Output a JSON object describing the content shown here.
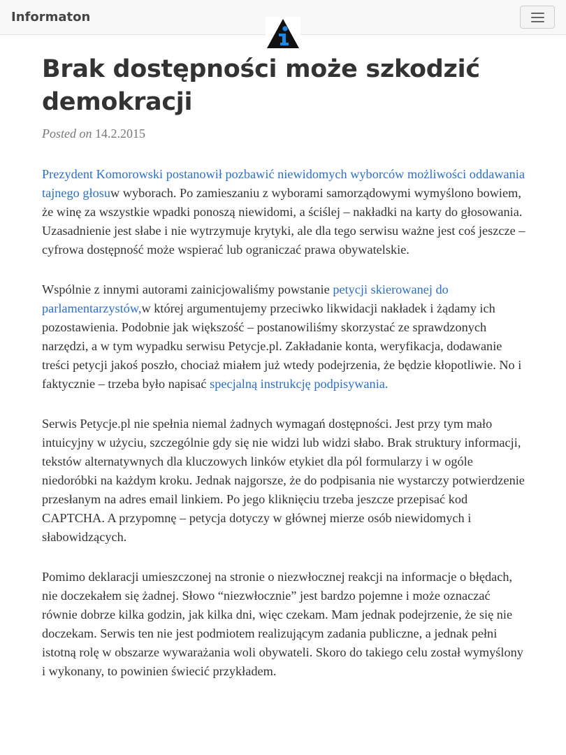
{
  "navbar": {
    "brand": "Informaton",
    "logo_icon": "info-triangle-logo-icon",
    "menu_icon": "hamburger-menu-icon"
  },
  "article": {
    "title": "Brak dostępności może szkodzić demokracji",
    "posted_label": "Posted on",
    "posted_date": "14.2.2015",
    "p1": {
      "link": "Prezydent Komorowski postanowił pozbawić niewidomych wyborców możliwości oddawania tajnego głosu",
      "text": "w wyborach. Po zamieszaniu z wyborami samorządowymi wymyślono bowiem, że winę za wszystkie wpadki ponoszą niewidomi, a ściślej – nakładki na karty do głosowania. Uzasadnienie jest słabe i nie wytrzymuje krytyki, ale dla tego serwisu ważne jest coś jeszcze – cyfrowa dostępność może wspierać lub ograniczać prawa obywatelskie."
    },
    "p2": {
      "text1": "Wspólnie z innymi autorami zainicjowaliśmy powstanie ",
      "link1": "petycji skierowanej do parlamentarzystów,",
      "text2": "w której argumentujemy przeciwko likwidacji nakładek i żądamy ich pozostawienia. Podobnie jak większość – postanowiliśmy skorzystać ze sprawdzonych narzędzi, a w tym wypadku serwisu Petycje.pl. Zakładanie konta, weryfikacja, dodawanie treści petycji jakoś poszło, chociaż miałem już wtedy podejrzenia, że będzie kłopotliwie. No i faktycznie – trzeba było napisać ",
      "link2": "specjalną instrukcję podpisywania."
    },
    "p3": "Serwis Petycje.pl nie spełnia niemal żadnych wymagań dostępności. Jest przy tym mało intuicyjny w użyciu, szczególnie gdy się nie widzi lub widzi słabo. Brak struktury informacji, tekstów alternatywnych dla kluczowych linków etykiet dla pól formularzy i w ogóle niedoróbki na każdym kroku. Jednak najgorsze, że do podpisania nie wystarczy potwierdzenie przesłanym na adres email linkiem. Po jego kliknięciu trzeba jeszcze przepisać kod CAPTCHA. A przypomnę – petycja dotyczy w głównej mierze osób niewidomych i słabowidzących.",
    "p4": "Pomimo deklaracji umieszczonej na stronie o niezwłocznej reakcji na informacje o błędach, nie doczekałem się żadnej. Słowo “niezwłocznie” jest bardzo pojemne i może oznaczać równie dobrze kilka godzin, jak kilka dni, więc czekam. Mam jednak podejrzenie, że się nie doczekam. Serwis ten nie jest podmiotem realizującym zadania publiczne, a jednak pełni istotną rolę w obszarze wywarażania woli obywateli. Skoro do takiego celu został wymyślony i wykonany, to powinien świecić przykładem."
  },
  "colors": {
    "navbar_bg": "#f8f8f8",
    "link": "#2a6fc9",
    "text": "#333333",
    "meta": "#777777",
    "logo_blue": "#1e88e5"
  }
}
